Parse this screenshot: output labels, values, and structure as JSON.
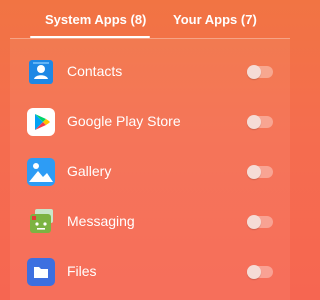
{
  "tabs": [
    {
      "label": "System Apps (8)",
      "active": true
    },
    {
      "label": "Your Apps (7)",
      "active": false
    }
  ],
  "apps": [
    {
      "name": "Contacts",
      "icon": "contacts-icon",
      "enabled": false
    },
    {
      "name": "Google Play Store",
      "icon": "google-play-icon",
      "enabled": false
    },
    {
      "name": "Gallery",
      "icon": "gallery-icon",
      "enabled": false
    },
    {
      "name": "Messaging",
      "icon": "messaging-icon",
      "enabled": false
    },
    {
      "name": "Files",
      "icon": "files-icon",
      "enabled": false
    }
  ],
  "colors": {
    "background_top": "#F17443",
    "background_bottom": "#F66651",
    "text": "#FFFFFF"
  }
}
